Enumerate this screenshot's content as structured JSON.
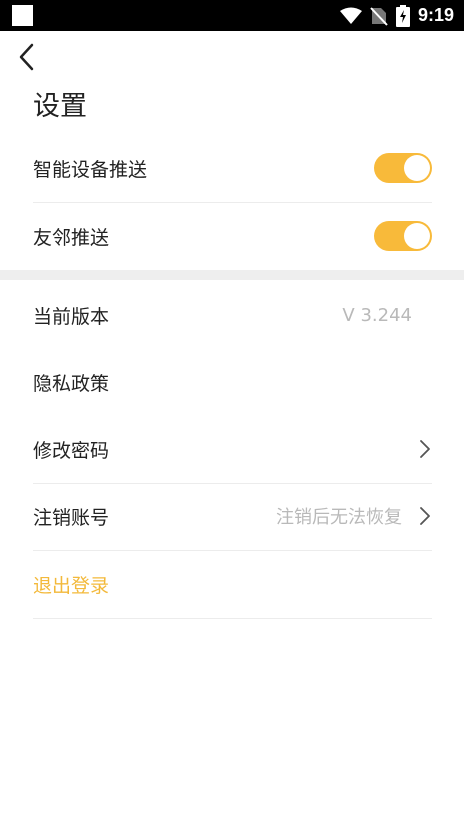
{
  "status_bar": {
    "time": "9:19"
  },
  "header": {
    "title": "设置"
  },
  "toggles": [
    {
      "label": "智能设备推送",
      "enabled": true
    },
    {
      "label": "友邻推送",
      "enabled": true
    }
  ],
  "settings": {
    "version_label": "当前版本",
    "version_value": "V 3.244",
    "privacy_label": "隐私政策",
    "change_password_label": "修改密码",
    "deactivate_label": "注销账号",
    "deactivate_hint": "注销后无法恢复",
    "logout_label": "退出登录"
  },
  "colors": {
    "accent": "#f8ba3a",
    "logout_text": "#f3b93b",
    "hint_text": "#b9b9b9"
  }
}
